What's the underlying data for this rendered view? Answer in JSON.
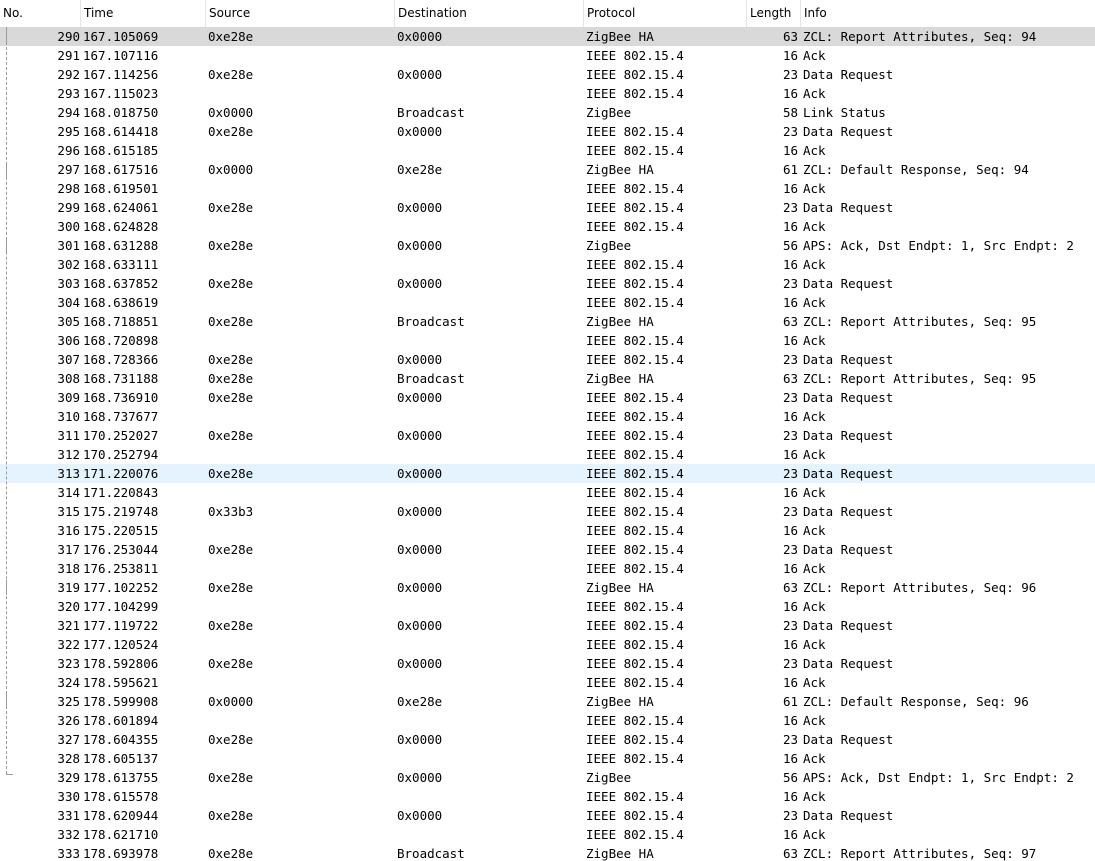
{
  "columns": {
    "no": "No.",
    "time": "Time",
    "source": "Source",
    "destination": "Destination",
    "protocol": "Protocol",
    "length": "Length",
    "info": "Info"
  },
  "selected_row": "290",
  "hovered_row": "313",
  "packets": [
    {
      "no": "290",
      "time": "167.105069",
      "source": "0xe28e",
      "destination": "0x0000",
      "protocol": "ZigBee HA",
      "length": "63",
      "info": "ZCL: Report Attributes, Seq: 94"
    },
    {
      "no": "291",
      "time": "167.107116",
      "source": "",
      "destination": "",
      "protocol": "IEEE 802.15.4",
      "length": "16",
      "info": "Ack"
    },
    {
      "no": "292",
      "time": "167.114256",
      "source": "0xe28e",
      "destination": "0x0000",
      "protocol": "IEEE 802.15.4",
      "length": "23",
      "info": "Data Request"
    },
    {
      "no": "293",
      "time": "167.115023",
      "source": "",
      "destination": "",
      "protocol": "IEEE 802.15.4",
      "length": "16",
      "info": "Ack"
    },
    {
      "no": "294",
      "time": "168.018750",
      "source": "0x0000",
      "destination": "Broadcast",
      "protocol": "ZigBee",
      "length": "58",
      "info": "Link Status"
    },
    {
      "no": "295",
      "time": "168.614418",
      "source": "0xe28e",
      "destination": "0x0000",
      "protocol": "IEEE 802.15.4",
      "length": "23",
      "info": "Data Request"
    },
    {
      "no": "296",
      "time": "168.615185",
      "source": "",
      "destination": "",
      "protocol": "IEEE 802.15.4",
      "length": "16",
      "info": "Ack"
    },
    {
      "no": "297",
      "time": "168.617516",
      "source": "0x0000",
      "destination": "0xe28e",
      "protocol": "ZigBee HA",
      "length": "61",
      "info": "ZCL: Default Response, Seq: 94"
    },
    {
      "no": "298",
      "time": "168.619501",
      "source": "",
      "destination": "",
      "protocol": "IEEE 802.15.4",
      "length": "16",
      "info": "Ack"
    },
    {
      "no": "299",
      "time": "168.624061",
      "source": "0xe28e",
      "destination": "0x0000",
      "protocol": "IEEE 802.15.4",
      "length": "23",
      "info": "Data Request"
    },
    {
      "no": "300",
      "time": "168.624828",
      "source": "",
      "destination": "",
      "protocol": "IEEE 802.15.4",
      "length": "16",
      "info": "Ack"
    },
    {
      "no": "301",
      "time": "168.631288",
      "source": "0xe28e",
      "destination": "0x0000",
      "protocol": "ZigBee",
      "length": "56",
      "info": "APS: Ack, Dst Endpt: 1, Src Endpt: 2"
    },
    {
      "no": "302",
      "time": "168.633111",
      "source": "",
      "destination": "",
      "protocol": "IEEE 802.15.4",
      "length": "16",
      "info": "Ack"
    },
    {
      "no": "303",
      "time": "168.637852",
      "source": "0xe28e",
      "destination": "0x0000",
      "protocol": "IEEE 802.15.4",
      "length": "23",
      "info": "Data Request"
    },
    {
      "no": "304",
      "time": "168.638619",
      "source": "",
      "destination": "",
      "protocol": "IEEE 802.15.4",
      "length": "16",
      "info": "Ack"
    },
    {
      "no": "305",
      "time": "168.718851",
      "source": "0xe28e",
      "destination": "Broadcast",
      "protocol": "ZigBee HA",
      "length": "63",
      "info": "ZCL: Report Attributes, Seq: 95"
    },
    {
      "no": "306",
      "time": "168.720898",
      "source": "",
      "destination": "",
      "protocol": "IEEE 802.15.4",
      "length": "16",
      "info": "Ack"
    },
    {
      "no": "307",
      "time": "168.728366",
      "source": "0xe28e",
      "destination": "0x0000",
      "protocol": "IEEE 802.15.4",
      "length": "23",
      "info": "Data Request"
    },
    {
      "no": "308",
      "time": "168.731188",
      "source": "0xe28e",
      "destination": "Broadcast",
      "protocol": "ZigBee HA",
      "length": "63",
      "info": "ZCL: Report Attributes, Seq: 95"
    },
    {
      "no": "309",
      "time": "168.736910",
      "source": "0xe28e",
      "destination": "0x0000",
      "protocol": "IEEE 802.15.4",
      "length": "23",
      "info": "Data Request"
    },
    {
      "no": "310",
      "time": "168.737677",
      "source": "",
      "destination": "",
      "protocol": "IEEE 802.15.4",
      "length": "16",
      "info": "Ack"
    },
    {
      "no": "311",
      "time": "170.252027",
      "source": "0xe28e",
      "destination": "0x0000",
      "protocol": "IEEE 802.15.4",
      "length": "23",
      "info": "Data Request"
    },
    {
      "no": "312",
      "time": "170.252794",
      "source": "",
      "destination": "",
      "protocol": "IEEE 802.15.4",
      "length": "16",
      "info": "Ack"
    },
    {
      "no": "313",
      "time": "171.220076",
      "source": "0xe28e",
      "destination": "0x0000",
      "protocol": "IEEE 802.15.4",
      "length": "23",
      "info": "Data Request"
    },
    {
      "no": "314",
      "time": "171.220843",
      "source": "",
      "destination": "",
      "protocol": "IEEE 802.15.4",
      "length": "16",
      "info": "Ack"
    },
    {
      "no": "315",
      "time": "175.219748",
      "source": "0x33b3",
      "destination": "0x0000",
      "protocol": "IEEE 802.15.4",
      "length": "23",
      "info": "Data Request"
    },
    {
      "no": "316",
      "time": "175.220515",
      "source": "",
      "destination": "",
      "protocol": "IEEE 802.15.4",
      "length": "16",
      "info": "Ack"
    },
    {
      "no": "317",
      "time": "176.253044",
      "source": "0xe28e",
      "destination": "0x0000",
      "protocol": "IEEE 802.15.4",
      "length": "23",
      "info": "Data Request"
    },
    {
      "no": "318",
      "time": "176.253811",
      "source": "",
      "destination": "",
      "protocol": "IEEE 802.15.4",
      "length": "16",
      "info": "Ack"
    },
    {
      "no": "319",
      "time": "177.102252",
      "source": "0xe28e",
      "destination": "0x0000",
      "protocol": "ZigBee HA",
      "length": "63",
      "info": "ZCL: Report Attributes, Seq: 96"
    },
    {
      "no": "320",
      "time": "177.104299",
      "source": "",
      "destination": "",
      "protocol": "IEEE 802.15.4",
      "length": "16",
      "info": "Ack"
    },
    {
      "no": "321",
      "time": "177.119722",
      "source": "0xe28e",
      "destination": "0x0000",
      "protocol": "IEEE 802.15.4",
      "length": "23",
      "info": "Data Request"
    },
    {
      "no": "322",
      "time": "177.120524",
      "source": "",
      "destination": "",
      "protocol": "IEEE 802.15.4",
      "length": "16",
      "info": "Ack"
    },
    {
      "no": "323",
      "time": "178.592806",
      "source": "0xe28e",
      "destination": "0x0000",
      "protocol": "IEEE 802.15.4",
      "length": "23",
      "info": "Data Request"
    },
    {
      "no": "324",
      "time": "178.595621",
      "source": "",
      "destination": "",
      "protocol": "IEEE 802.15.4",
      "length": "16",
      "info": "Ack"
    },
    {
      "no": "325",
      "time": "178.599908",
      "source": "0x0000",
      "destination": "0xe28e",
      "protocol": "ZigBee HA",
      "length": "61",
      "info": "ZCL: Default Response, Seq: 96"
    },
    {
      "no": "326",
      "time": "178.601894",
      "source": "",
      "destination": "",
      "protocol": "IEEE 802.15.4",
      "length": "16",
      "info": "Ack"
    },
    {
      "no": "327",
      "time": "178.604355",
      "source": "0xe28e",
      "destination": "0x0000",
      "protocol": "IEEE 802.15.4",
      "length": "23",
      "info": "Data Request"
    },
    {
      "no": "328",
      "time": "178.605137",
      "source": "",
      "destination": "",
      "protocol": "IEEE 802.15.4",
      "length": "16",
      "info": "Ack"
    },
    {
      "no": "329",
      "time": "178.613755",
      "source": "0xe28e",
      "destination": "0x0000",
      "protocol": "ZigBee",
      "length": "56",
      "info": "APS: Ack, Dst Endpt: 1, Src Endpt: 2"
    },
    {
      "no": "330",
      "time": "178.615578",
      "source": "",
      "destination": "",
      "protocol": "IEEE 802.15.4",
      "length": "16",
      "info": "Ack"
    },
    {
      "no": "331",
      "time": "178.620944",
      "source": "0xe28e",
      "destination": "0x0000",
      "protocol": "IEEE 802.15.4",
      "length": "23",
      "info": "Data Request"
    },
    {
      "no": "332",
      "time": "178.621710",
      "source": "",
      "destination": "",
      "protocol": "IEEE 802.15.4",
      "length": "16",
      "info": "Ack"
    },
    {
      "no": "333",
      "time": "178.693978",
      "source": "0xe28e",
      "destination": "Broadcast",
      "protocol": "ZigBee HA",
      "length": "63",
      "info": "ZCL: Report Attributes, Seq: 97"
    }
  ]
}
